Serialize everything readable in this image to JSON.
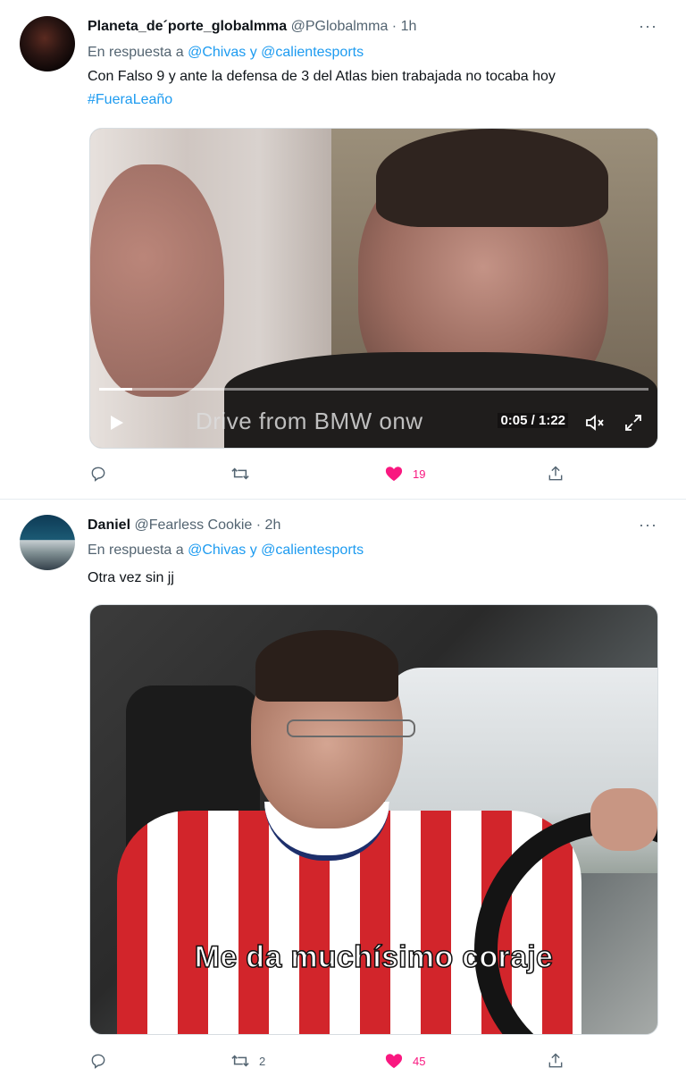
{
  "tweets": [
    {
      "display_name": "Planeta_de´porte_globalmma",
      "handle": "@PGlobalmma",
      "separator": "·",
      "time": "1h",
      "more": "···",
      "reply_prefix": "En respuesta a",
      "reply_mention_1": "@Chivas",
      "reply_and": "y",
      "reply_mention_2": "@calientesports",
      "text": "Con Falso 9 y ante la defensa de 3 del Atlas bien trabajada no tocaba hoy",
      "hashtag": "#FueraLeaño",
      "video": {
        "caption_overlay": "Drive from BMW onw",
        "time_readout": "0:05 / 1:22",
        "progress": 0.06
      },
      "actions": {
        "reply_count": "",
        "retweet_count": "",
        "like_count": "19",
        "liked": true
      }
    },
    {
      "display_name": "Daniel",
      "handle": "@Fearless Cookie",
      "separator": "·",
      "time": "2h",
      "more": "···",
      "reply_prefix": "En respuesta a",
      "reply_mention_1": "@Chivas",
      "reply_and": "y",
      "reply_mention_2": "@calientesports",
      "text": "Otra vez sin jj",
      "gif": {
        "caption": "Me da muchísimo coraje"
      },
      "actions": {
        "reply_count": "",
        "retweet_count": "2",
        "like_count": "45",
        "liked": true
      }
    }
  ],
  "icons": {
    "reply": "reply-icon",
    "retweet": "retweet-icon",
    "like": "heart-icon",
    "share": "share-icon",
    "play": "play-icon",
    "mute": "mute-icon",
    "expand": "expand-icon"
  },
  "colors": {
    "link": "#1d9bf0",
    "like": "#f91880",
    "muted_text": "#536471"
  }
}
